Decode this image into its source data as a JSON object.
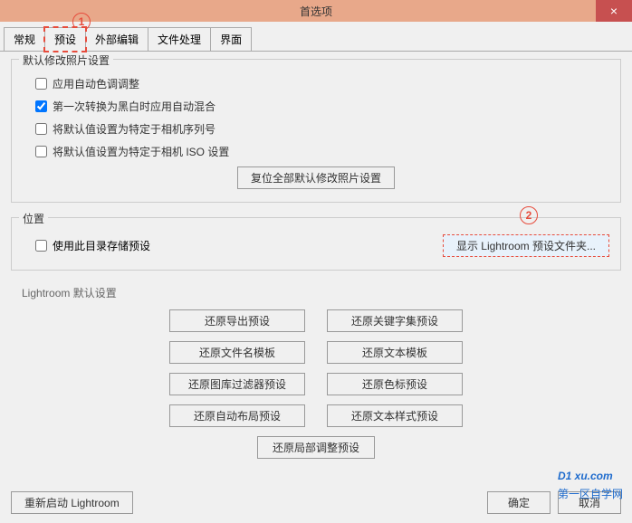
{
  "window": {
    "title": "首选项",
    "close": "×"
  },
  "tabs": [
    "常规",
    "预设",
    "外部编辑",
    "文件处理",
    "界面"
  ],
  "group1": {
    "legend": "默认修改照片设置",
    "cb1": "应用自动色调调整",
    "cb2": "第一次转换为黑白时应用自动混合",
    "cb3": "将默认值设置为特定于相机序列号",
    "cb4": "将默认值设置为特定于相机 ISO 设置",
    "resetBtn": "复位全部默认修改照片设置"
  },
  "group2": {
    "legend": "位置",
    "cb1": "使用此目录存储预设",
    "showBtn": "显示 Lightroom 预设文件夹..."
  },
  "group3": {
    "legend": "Lightroom 默认设置",
    "b1": "还原导出预设",
    "b2": "还原关键字集预设",
    "b3": "还原文件名模板",
    "b4": "还原文本模板",
    "b5": "还原图库过滤器预设",
    "b6": "还原色标预设",
    "b7": "还原自动布局预设",
    "b8": "还原文本样式预设",
    "b9": "还原局部调整预设"
  },
  "bottom": {
    "restart": "重新启动 Lightroom",
    "ok": "确定",
    "cancel": "取消"
  },
  "annot": {
    "c1": "1",
    "c2": "2"
  },
  "watermark": {
    "main": "D1 xu.com",
    "sub": "第一区自学网"
  }
}
